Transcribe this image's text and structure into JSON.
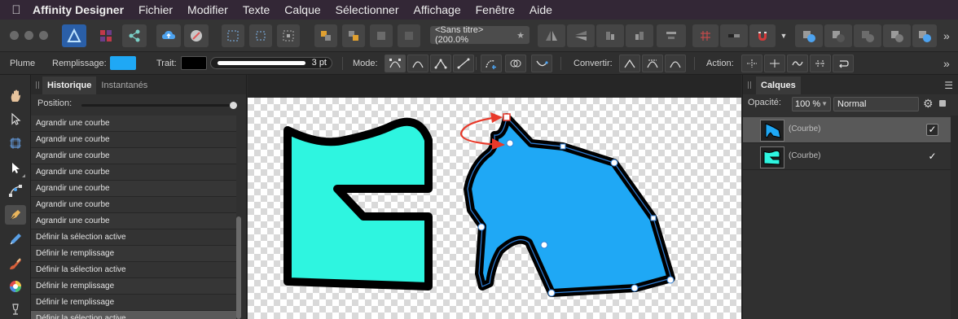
{
  "menubar": {
    "apple_icon": "apple-icon",
    "app_name": "Affinity Designer",
    "items": [
      "Fichier",
      "Modifier",
      "Texte",
      "Calque",
      "Sélectionner",
      "Affichage",
      "Fenêtre",
      "Aide"
    ]
  },
  "toolbar": {
    "document_tab": "<Sans titre> (200.0%",
    "document_tab_modified": "★",
    "more_icon": "»"
  },
  "context_toolbar": {
    "tool_name": "Plume",
    "fill_label": "Remplissage:",
    "fill_color": "#1fa8f5",
    "stroke_label": "Trait:",
    "stroke_color": "#000000",
    "stroke_width": "3 pt",
    "mode_label": "Mode:",
    "convert_label": "Convertir:",
    "action_label": "Action:",
    "more_icon": "»"
  },
  "history": {
    "tab_history": "Historique",
    "tab_snapshots": "Instantanés",
    "position_label": "Position:",
    "rows": [
      "Agrandir une courbe",
      "Agrandir une courbe",
      "Agrandir une courbe",
      "Agrandir une courbe",
      "Agrandir une courbe",
      "Agrandir une courbe",
      "Agrandir une courbe",
      "Définir la sélection active",
      "Définir le remplissage",
      "Définir la sélection active",
      "Définir le remplissage",
      "Définir le remplissage",
      "Définir la sélection active"
    ]
  },
  "layers": {
    "tab_layers": "Calques",
    "menu_icon": "hamburger-menu-icon",
    "opacity_label": "Opacité:",
    "opacity_value": "100 %",
    "blend_mode": "Normal",
    "items": [
      {
        "name": "(Courbe)",
        "visible": "✓"
      },
      {
        "name": "(Courbe)",
        "visible": "✓"
      }
    ]
  },
  "colors": {
    "accent_selection": "#2f7fd8",
    "shape_cyan": "#2ef5e0",
    "shape_blue": "#1fa8f5",
    "annotation_red": "#e8392a"
  }
}
